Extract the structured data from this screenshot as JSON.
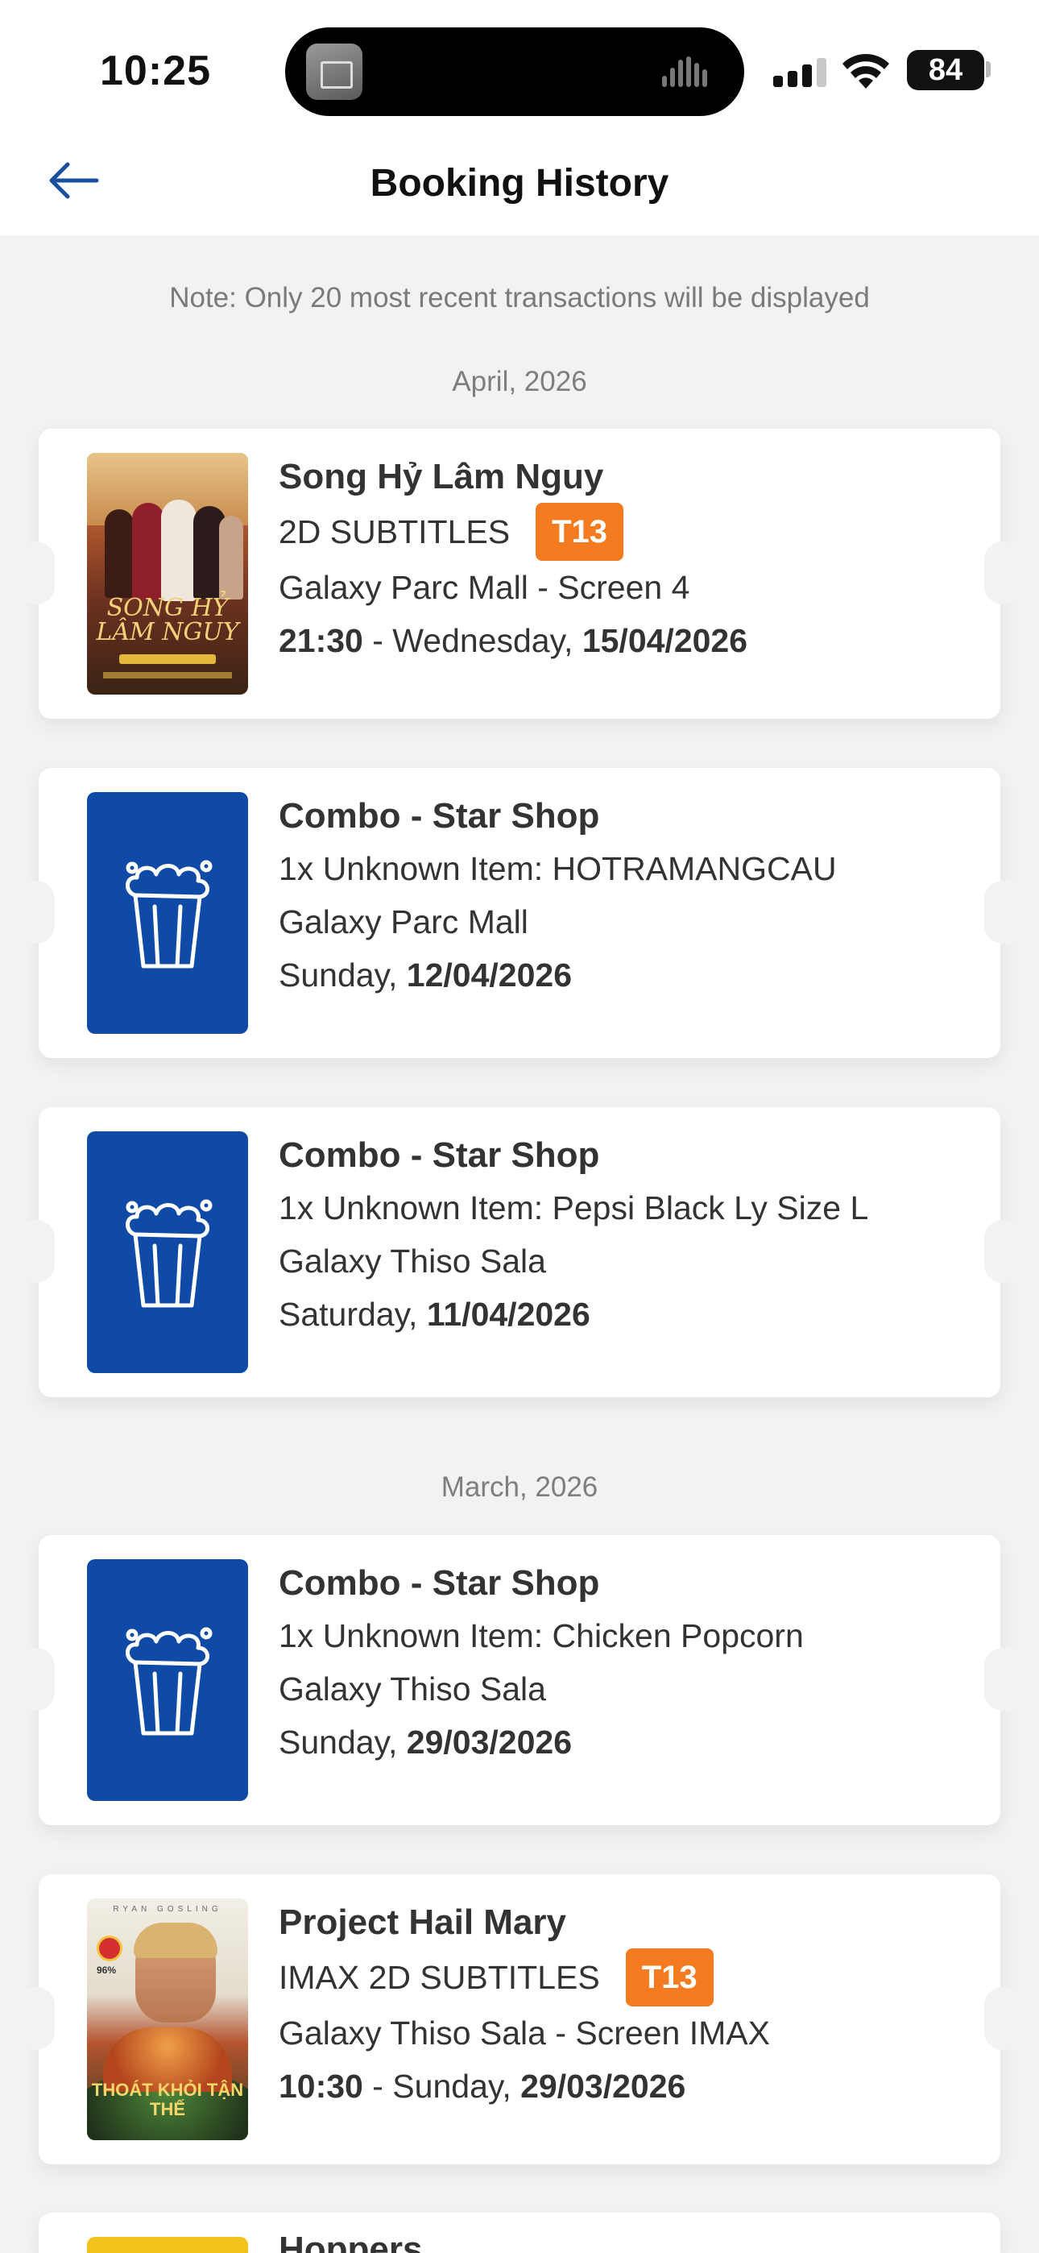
{
  "status_bar": {
    "time": "10:25",
    "battery": "84"
  },
  "header": {
    "title": "Booking History"
  },
  "note": "Note: Only 20 most recent transactions will be displayed",
  "groups": [
    {
      "month": "April, 2026"
    },
    {
      "month": "March, 2026"
    }
  ],
  "bookings": [
    {
      "type": "movie",
      "title": "Song Hỷ Lâm Nguy",
      "format": "2D SUBTITLES",
      "rating": "T13",
      "location": "Galaxy Parc Mall - Screen 4",
      "showtime": "21:30",
      "weekday": " - Wednesday, ",
      "date": "15/04/2026",
      "poster_text": "SONG HỶ LÂM NGUY"
    },
    {
      "type": "combo",
      "title": "Combo - Star Shop",
      "item": "1x Unknown Item: HOTRAMANGCAU",
      "location": "Galaxy Parc Mall",
      "weekday": "Sunday, ",
      "date": "12/04/2026"
    },
    {
      "type": "combo",
      "title": "Combo - Star Shop",
      "item": "1x Unknown Item: Pepsi Black Ly Size L",
      "location": "Galaxy Thiso Sala",
      "weekday": "Saturday, ",
      "date": "11/04/2026"
    },
    {
      "type": "combo",
      "title": "Combo - Star Shop",
      "item": "1x Unknown Item: Chicken Popcorn",
      "location": "Galaxy Thiso Sala",
      "weekday": "Sunday, ",
      "date": "29/03/2026"
    },
    {
      "type": "movie",
      "title": "Project Hail Mary",
      "format": "IMAX 2D SUBTITLES",
      "rating": "T13",
      "location": "Galaxy Thiso Sala - Screen IMAX",
      "showtime": "10:30",
      "weekday": " - Sunday, ",
      "date": "29/03/2026",
      "poster_top": "RYAN GOSLING",
      "poster_text": "THOÁT KHỎI TẬN THẾ",
      "poster_score": "96%"
    },
    {
      "type": "movie",
      "title": "Hoppers"
    }
  ],
  "colors": {
    "accent": "#f57b20",
    "combo_bg": "#0f4ba6",
    "back_arrow": "#1a4fa0"
  },
  "icons": {
    "back": "arrow-left-icon",
    "combo": "popcorn-icon"
  }
}
